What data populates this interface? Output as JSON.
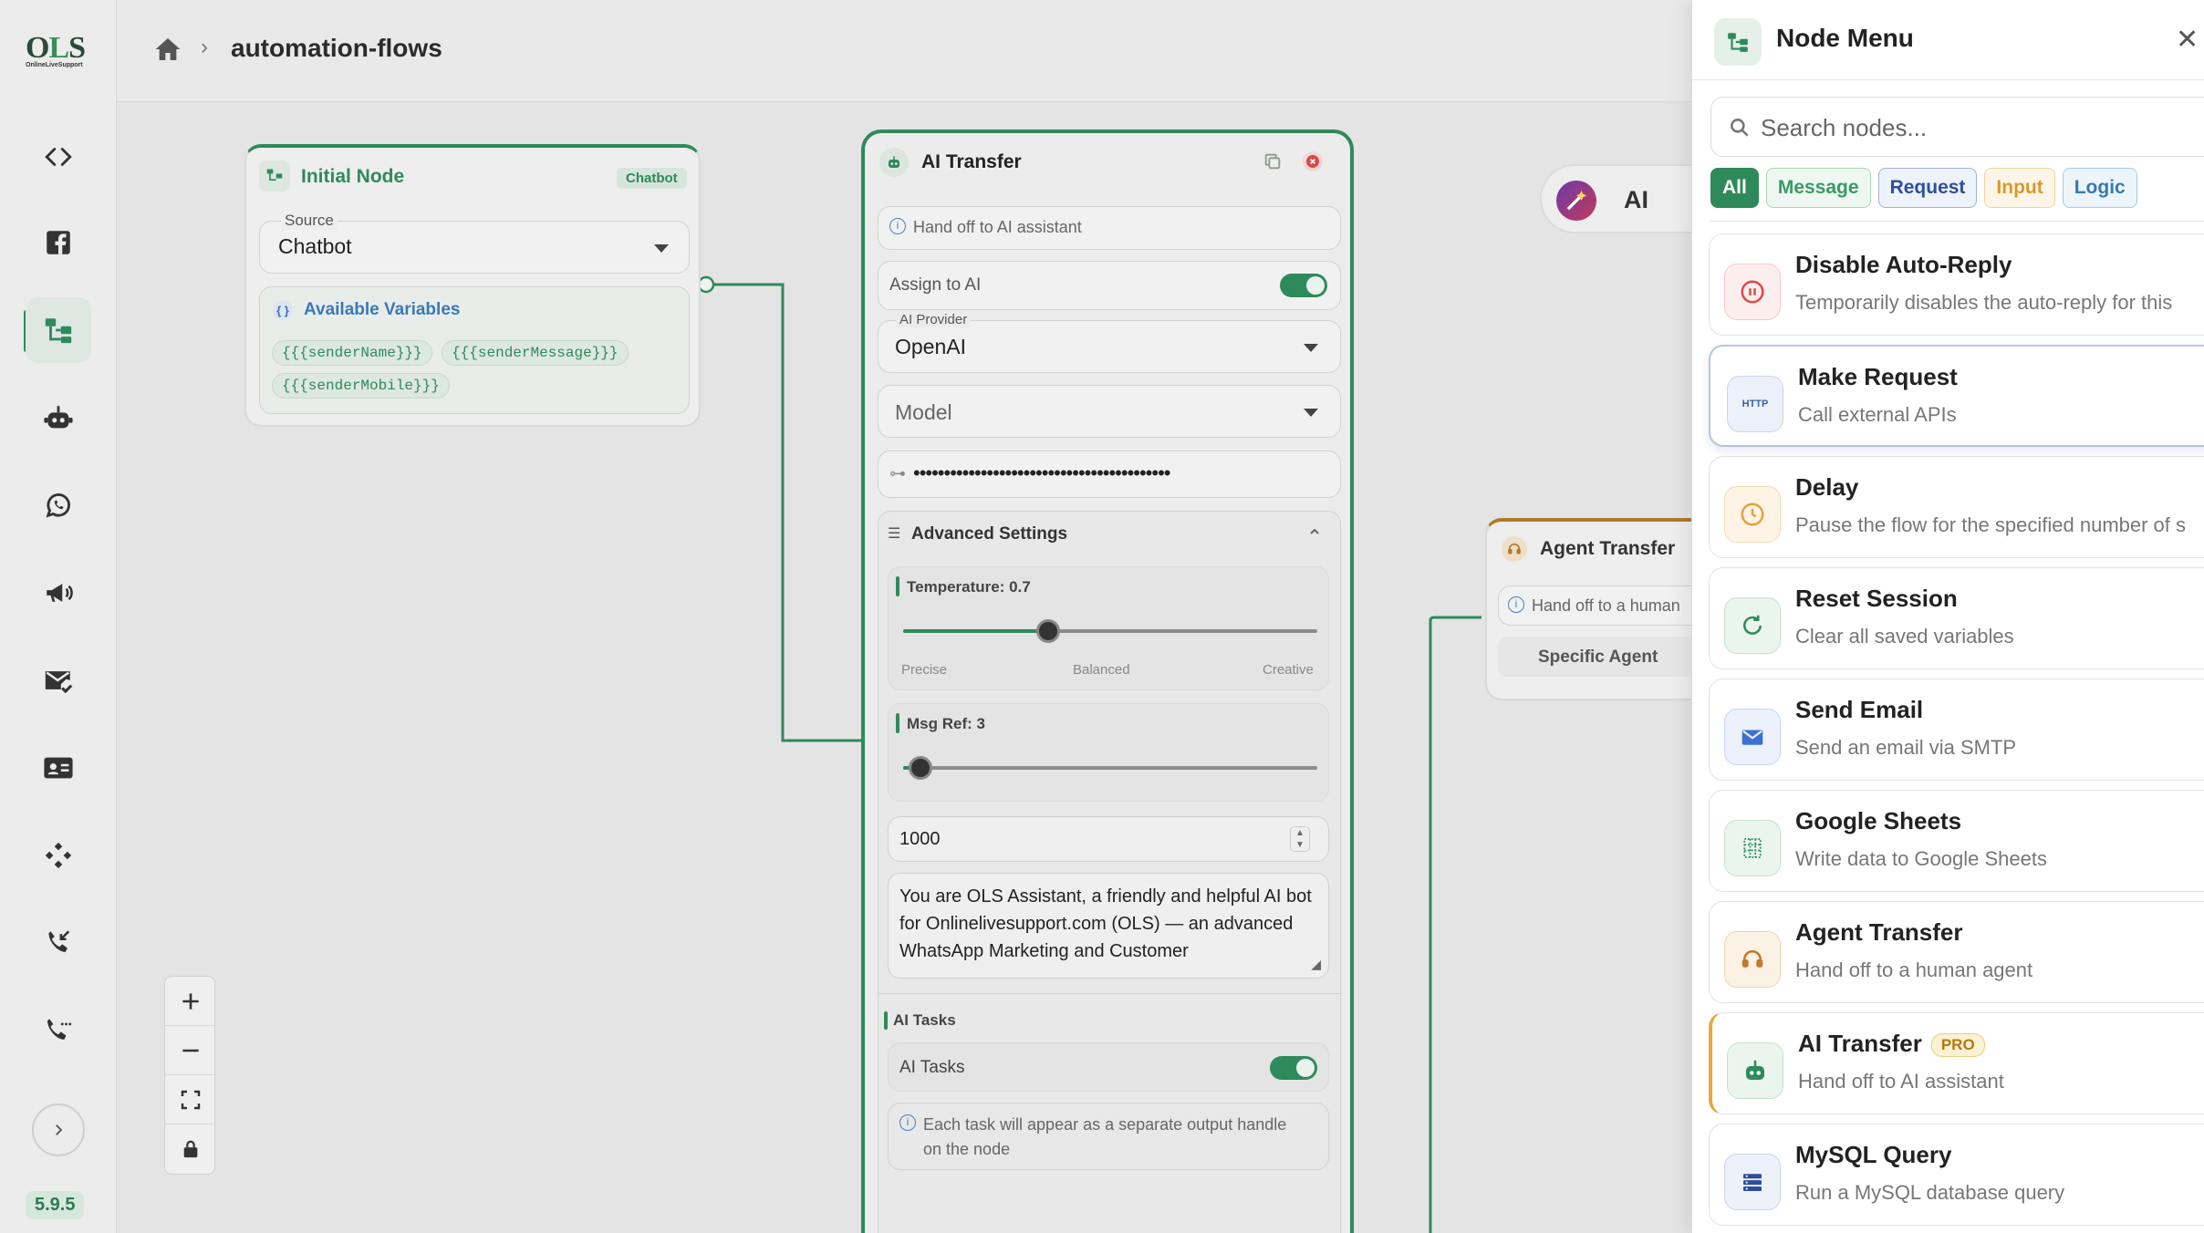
{
  "app": {
    "logo_text": "OLS",
    "logo_sub": "OnlineLiveSupport",
    "version": "5.9.5"
  },
  "header": {
    "breadcrumb_title": "automation-flows",
    "separator": "›"
  },
  "sidebar": {
    "items": [
      {
        "name": "code-icon"
      },
      {
        "name": "facebook-icon"
      },
      {
        "name": "flow-icon",
        "active": true
      },
      {
        "name": "bot-icon"
      },
      {
        "name": "whatsapp-icon"
      },
      {
        "name": "megaphone-icon"
      },
      {
        "name": "mail-check-icon"
      },
      {
        "name": "contact-card-icon"
      },
      {
        "name": "integrations-icon"
      },
      {
        "name": "incoming-call-icon"
      },
      {
        "name": "call-log-icon"
      }
    ]
  },
  "canvas": {
    "initial_node": {
      "title": "Initial Node",
      "chip": "Chatbot",
      "source_label": "Source",
      "source_value": "Chatbot",
      "variables_title": "Available Variables",
      "variables": [
        "{{{senderName}}}",
        "{{{senderMessage}}}",
        "{{{senderMobile}}}"
      ]
    },
    "ai_node": {
      "title": "AI Transfer",
      "hint": "Hand off to AI assistant",
      "assign_label": "Assign to AI",
      "provider_label": "AI Provider",
      "provider_value": "OpenAI",
      "model_placeholder": "Model",
      "api_key_mask": "••••••••••••••••••••••••••••••••••••••••••",
      "advanced_title": "Advanced Settings",
      "temperature_label": "Temperature: 0.7",
      "temperature_value": 0.7,
      "temp_captions": [
        "Precise",
        "Balanced",
        "Creative"
      ],
      "msgref_label": "Msg Ref: 3",
      "msgref_value": 3,
      "max_tokens": "1000",
      "prompt_text": "You are OLS Assistant, a friendly and helpful AI bot for Onlinelivesupport.com (OLS) — an advanced WhatsApp Marketing and Customer",
      "tasks_section": "AI Tasks",
      "tasks_toggle_label": "AI Tasks",
      "tasks_hint": "Each task will appear as a separate output handle on the node"
    },
    "agent_node": {
      "title": "Agent Transfer",
      "hint": "Hand off to a human",
      "button": "Specific Agent"
    },
    "ai_pill_label": "AI"
  },
  "node_menu": {
    "title": "Node Menu",
    "search_placeholder": "Search nodes...",
    "filters": [
      "All",
      "Message",
      "Request",
      "Input",
      "Logic"
    ],
    "items": [
      {
        "title": "Disable Auto-Reply",
        "desc": "Temporarily disables the auto-reply for this",
        "icon": "pause-circle-icon",
        "color": "#e04848"
      },
      {
        "title": "Make Request",
        "desc": "Call external APIs",
        "icon": "http-icon",
        "color": "#3a5ea8"
      },
      {
        "title": "Delay",
        "desc": "Pause the flow for the specified number of s",
        "icon": "clock-icon",
        "color": "#e7a03b"
      },
      {
        "title": "Reset Session",
        "desc": "Clear all saved variables",
        "icon": "refresh-icon",
        "color": "#2f8a5b"
      },
      {
        "title": "Send Email",
        "desc": "Send an email via SMTP",
        "icon": "mail-icon",
        "color": "#3b6fd4"
      },
      {
        "title": "Google Sheets",
        "desc": "Write data to Google Sheets",
        "icon": "sheets-icon",
        "color": "#2f8a5b"
      },
      {
        "title": "Agent Transfer",
        "desc": "Hand off to a human agent",
        "icon": "headset-icon",
        "color": "#c07a28"
      },
      {
        "title": "AI Transfer",
        "desc": "Hand off to AI assistant",
        "icon": "bot-icon",
        "color": "#2f8a5b",
        "badge": "PRO"
      },
      {
        "title": "MySQL Query",
        "desc": "Run a MySQL database query",
        "icon": "database-icon",
        "color": "#2c4f9a"
      }
    ]
  }
}
